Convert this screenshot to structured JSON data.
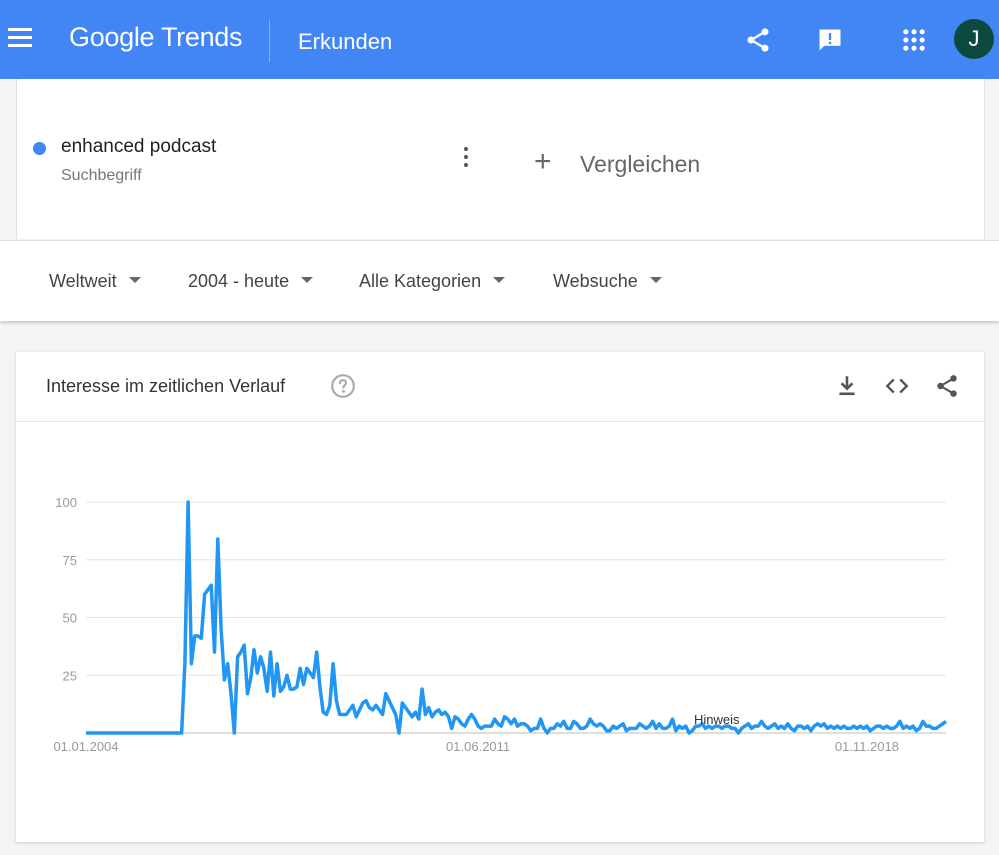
{
  "header": {
    "logo_google": "Google",
    "logo_trends": "Trends",
    "page_title": "Erkunden",
    "avatar_letter": "J"
  },
  "colors": {
    "header_bg": "#4285f4",
    "series_line": "#2196f3",
    "term_dot": "#4285f4",
    "avatar_bg": "#0b4a3c"
  },
  "icons": {
    "menu": "menu-icon",
    "share": "share-icon",
    "feedback": "feedback-icon",
    "apps": "apps-grid-icon",
    "more": "more-vert-icon",
    "add": "plus-icon",
    "dropdown": "caret-down-icon",
    "help": "help-circle-icon",
    "download": "download-icon",
    "embed": "code-icon"
  },
  "term": {
    "name": "enhanced podcast",
    "type": "Suchbegriff"
  },
  "compare": {
    "plus": "+",
    "label": "Vergleichen"
  },
  "filters": [
    {
      "label": "Weltweit"
    },
    {
      "label": "2004 - heute"
    },
    {
      "label": "Alle Kategorien"
    },
    {
      "label": "Websuche"
    }
  ],
  "chart_card": {
    "title": "Interesse im zeitlichen Verlauf"
  },
  "chart_data": {
    "type": "line",
    "title": "Interesse im zeitlichen Verlauf",
    "xlabel": "",
    "ylabel": "",
    "ylim": [
      0,
      100
    ],
    "yticks": [
      100,
      75,
      50,
      25
    ],
    "xtick_labels": [
      "01.01.2004",
      "01.06.2011",
      "01.11.2018"
    ],
    "x_start": "2004-01",
    "x_end": "2020-06",
    "grid": true,
    "annotation": "Hinweis",
    "series": [
      {
        "name": "enhanced podcast",
        "values": [
          0,
          0,
          0,
          0,
          0,
          0,
          0,
          0,
          0,
          0,
          0,
          0,
          0,
          0,
          0,
          0,
          0,
          0,
          0,
          0,
          0,
          0,
          0,
          0,
          0,
          0,
          0,
          0,
          0,
          0,
          30,
          100,
          30,
          42,
          42,
          41,
          60,
          62,
          64,
          35,
          84,
          45,
          23,
          30,
          17,
          0,
          33,
          35,
          38,
          17,
          24,
          36,
          26,
          33,
          28,
          18,
          35,
          16,
          30,
          18,
          20,
          25,
          19,
          19,
          20,
          28,
          21,
          28,
          26,
          24,
          35,
          20,
          9,
          8,
          12,
          30,
          14,
          8,
          8,
          8,
          10,
          12,
          7,
          10,
          13,
          14,
          11,
          10,
          12,
          10,
          8,
          17,
          14,
          11,
          8,
          0,
          13,
          11,
          9,
          7,
          9,
          6,
          19,
          8,
          11,
          7,
          9,
          10,
          8,
          9,
          7,
          2,
          7,
          6,
          4,
          3,
          6,
          8,
          6,
          3,
          2,
          3,
          3,
          3,
          6,
          4,
          3,
          7,
          6,
          4,
          6,
          3,
          4,
          4,
          3,
          1,
          2,
          2,
          6,
          2,
          0,
          2,
          2,
          4,
          3,
          5,
          2,
          2,
          5,
          4,
          2,
          2,
          3,
          6,
          4,
          3,
          4,
          3,
          1,
          1,
          3,
          2,
          3,
          4,
          1,
          2,
          2,
          2,
          4,
          3,
          2,
          3,
          5,
          2,
          4,
          2,
          2,
          3,
          6,
          1,
          3,
          2,
          3,
          0,
          1,
          3,
          3,
          4,
          2,
          3,
          2,
          3,
          3,
          2,
          3,
          3,
          2,
          2,
          0,
          2,
          3,
          4,
          2,
          3,
          3,
          5,
          3,
          2,
          3,
          4,
          2,
          3,
          2,
          4,
          2,
          1,
          3,
          3,
          2,
          3,
          1,
          3,
          4,
          3,
          4,
          2,
          3,
          2,
          3,
          2,
          3,
          2,
          2,
          3,
          2,
          3,
          2,
          3,
          1,
          2,
          3,
          3,
          2,
          3,
          2,
          2,
          3,
          5,
          2,
          3,
          2,
          3,
          1,
          2,
          5,
          3,
          3,
          2,
          2,
          3,
          4,
          5
        ]
      }
    ]
  }
}
